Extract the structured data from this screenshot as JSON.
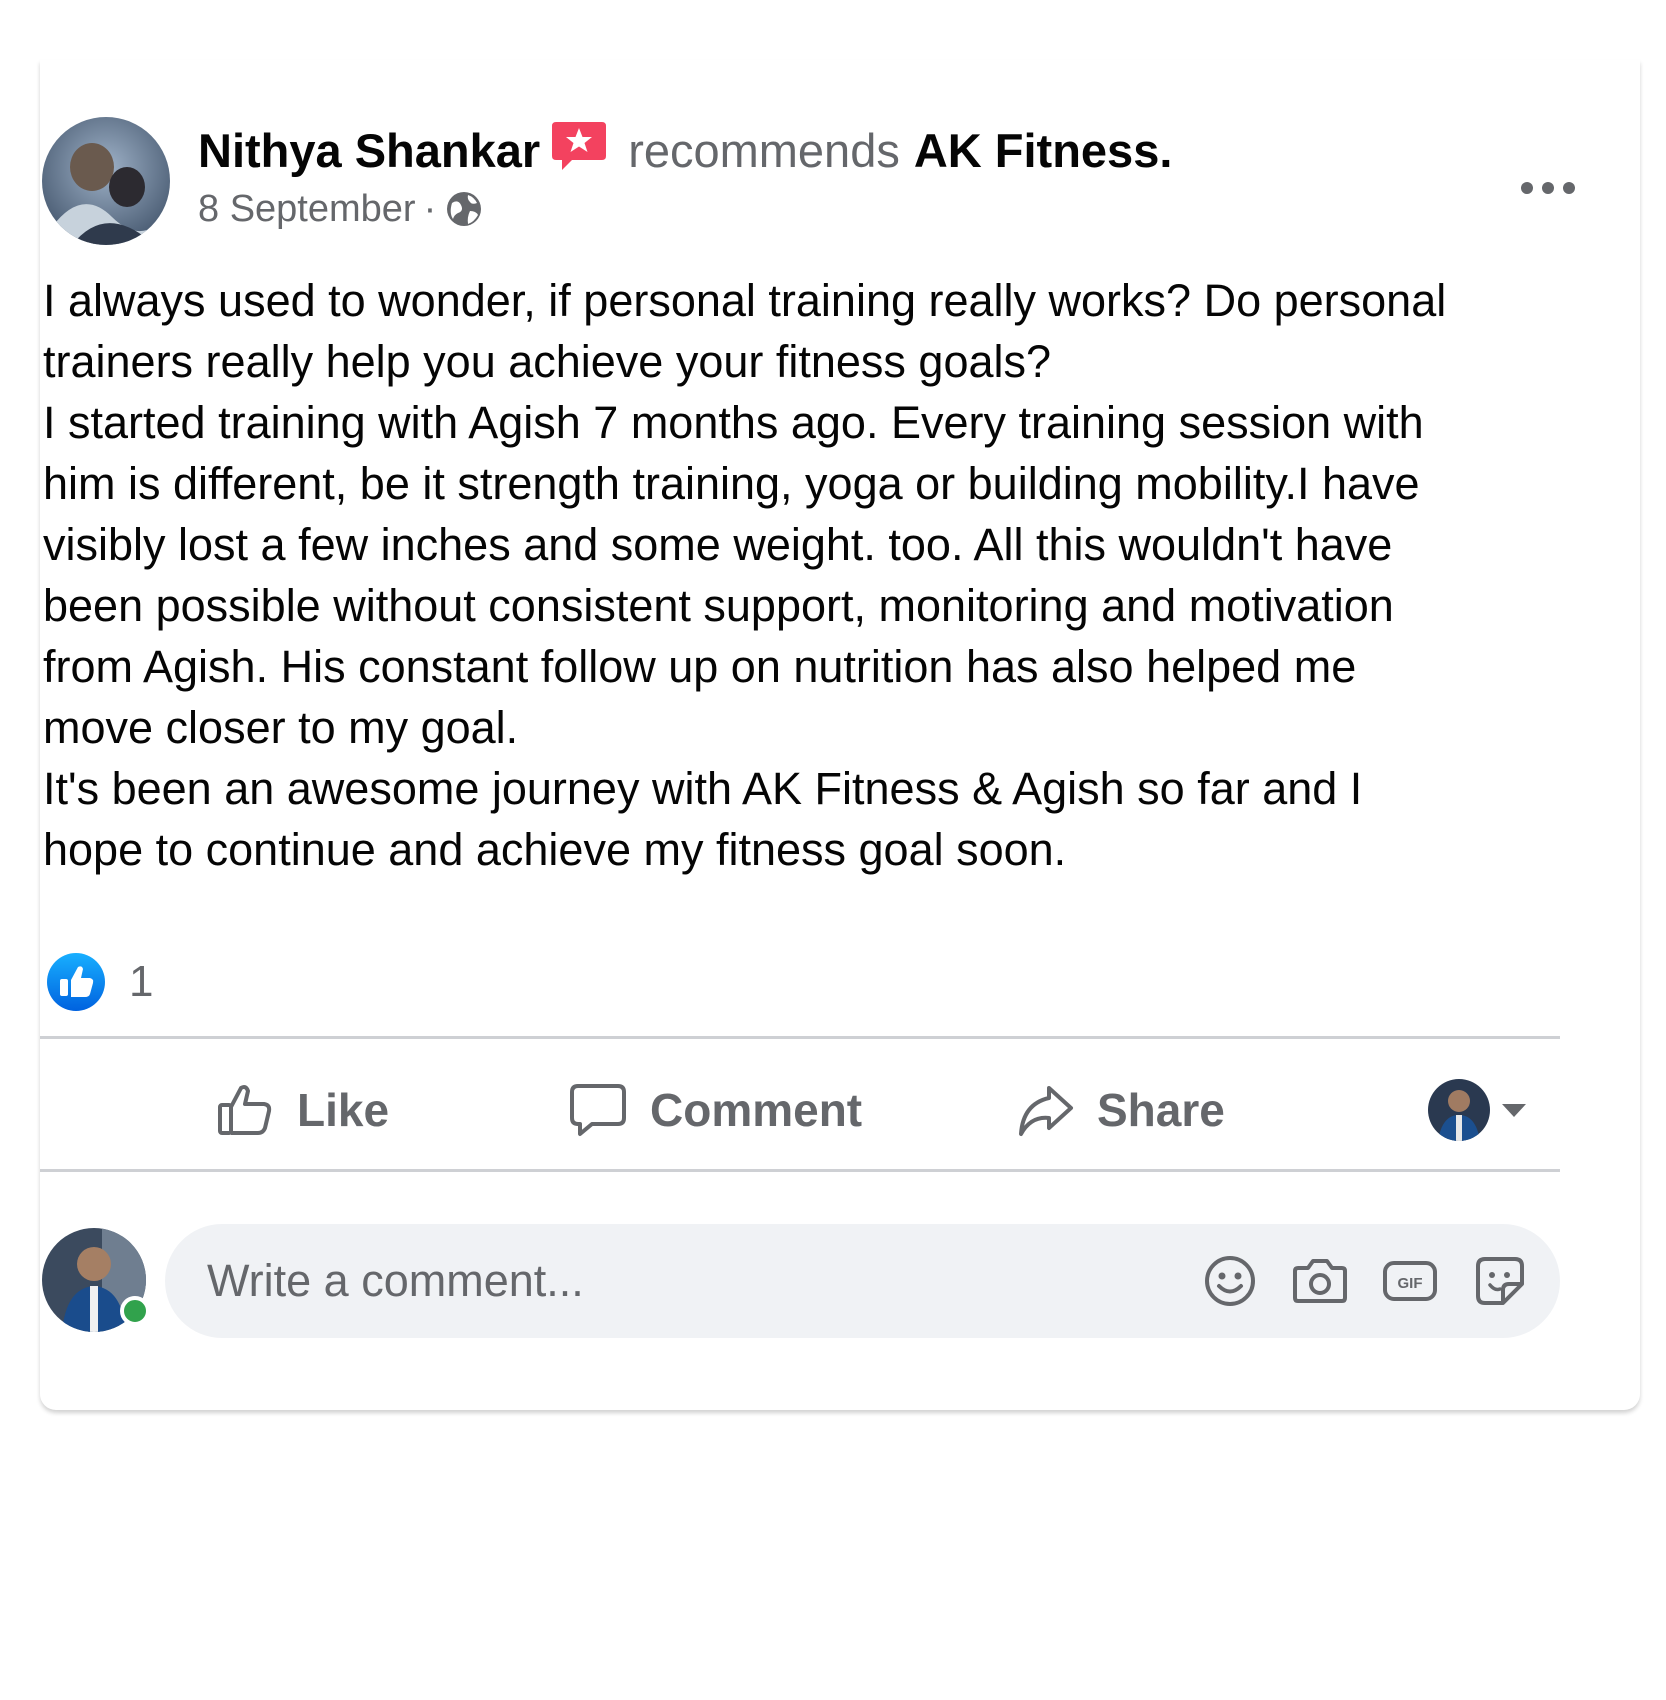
{
  "post": {
    "author": "Nithya Shankar",
    "action_text": "recommends",
    "page_name": "AK Fitness.",
    "date": "8 September",
    "separator": "·",
    "audience_icon": "globe-icon",
    "more_icon": "more-options-icon",
    "body_lines": [
      "I always used to wonder, if personal training really works? Do personal",
      "trainers really help you achieve your fitness goals?",
      "I started training with Agish 7 months ago. Every training session  with",
      "him is different, be it strength training, yoga or building mobility.I have",
      "visibly lost a few inches and some weight. too. All this wouldn't have",
      "been possible without consistent support, monitoring and motivation",
      "from Agish. His constant follow up on nutrition has also helped me",
      "move closer to my goal.",
      "It's been an awesome journey with AK Fitness & Agish so far and I",
      "hope to continue and achieve my fitness goal soon."
    ]
  },
  "reactions": {
    "icon": "like-reaction-icon",
    "count": "1"
  },
  "actions": {
    "like_label": "Like",
    "comment_label": "Comment",
    "share_label": "Share"
  },
  "composer": {
    "placeholder": "Write a comment...",
    "icons": [
      "emoji-icon",
      "camera-icon",
      "gif-icon",
      "sticker-icon"
    ]
  },
  "colors": {
    "secondary_text": "#65676b",
    "primary_text": "#050505",
    "like_blue": "#1877f2",
    "recommend_badge": "#f3425f",
    "online_green": "#31a24c",
    "composer_bg": "#f0f2f5",
    "divider": "#ced0d4"
  }
}
